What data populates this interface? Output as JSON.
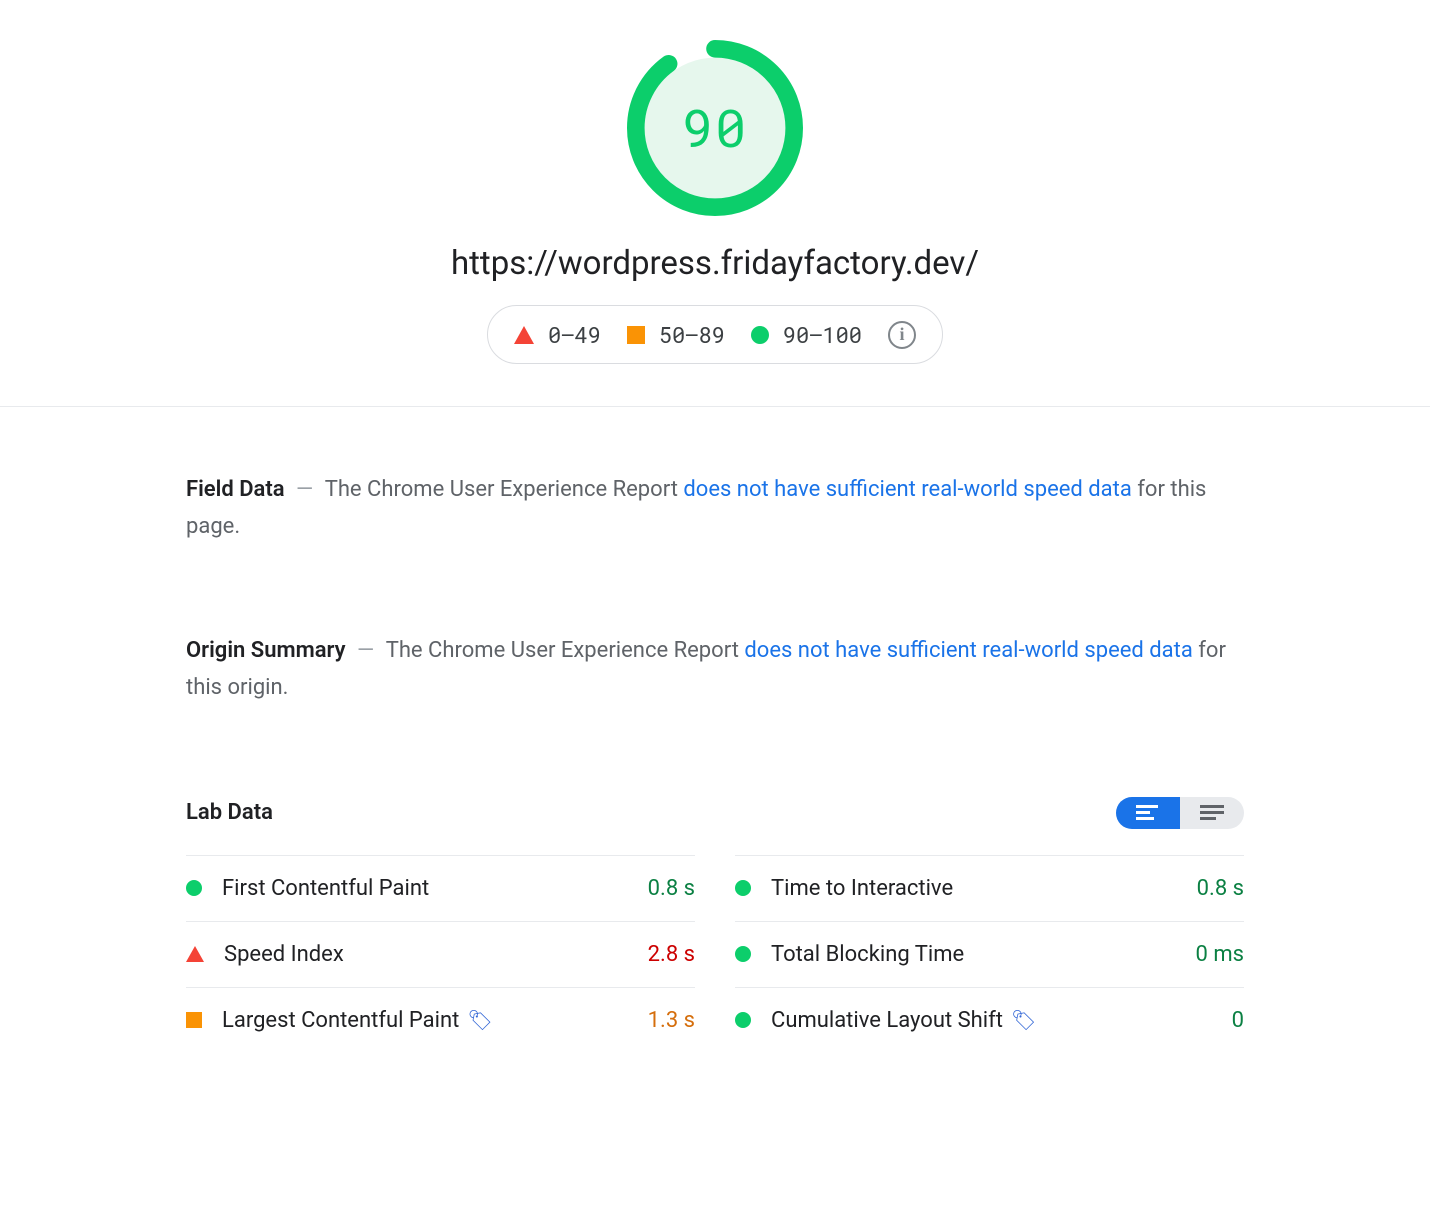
{
  "score": "90",
  "url": "https://wordpress.fridayfactory.dev/",
  "legend": {
    "poor": "0–49",
    "avg": "50–89",
    "good": "90–100"
  },
  "field_data": {
    "heading": "Field Data",
    "body_prefix": "The Chrome User Experience Report ",
    "link_text": "does not have sufficient real-world speed data",
    "body_suffix": " for this page."
  },
  "origin_summary": {
    "heading": "Origin Summary",
    "body_prefix": "The Chrome User Experience Report ",
    "link_text": "does not have sufficient real-world speed data",
    "body_suffix": " for this origin."
  },
  "lab_heading": "Lab Data",
  "metrics": {
    "fcp": {
      "label": "First Contentful Paint",
      "value": "0.8 s"
    },
    "tti": {
      "label": "Time to Interactive",
      "value": "0.8 s"
    },
    "si": {
      "label": "Speed Index",
      "value": "2.8 s"
    },
    "tbt": {
      "label": "Total Blocking Time",
      "value": "0 ms"
    },
    "lcp": {
      "label": "Largest Contentful Paint",
      "value": "1.3 s"
    },
    "cls": {
      "label": "Cumulative Layout Shift",
      "value": "0"
    }
  }
}
